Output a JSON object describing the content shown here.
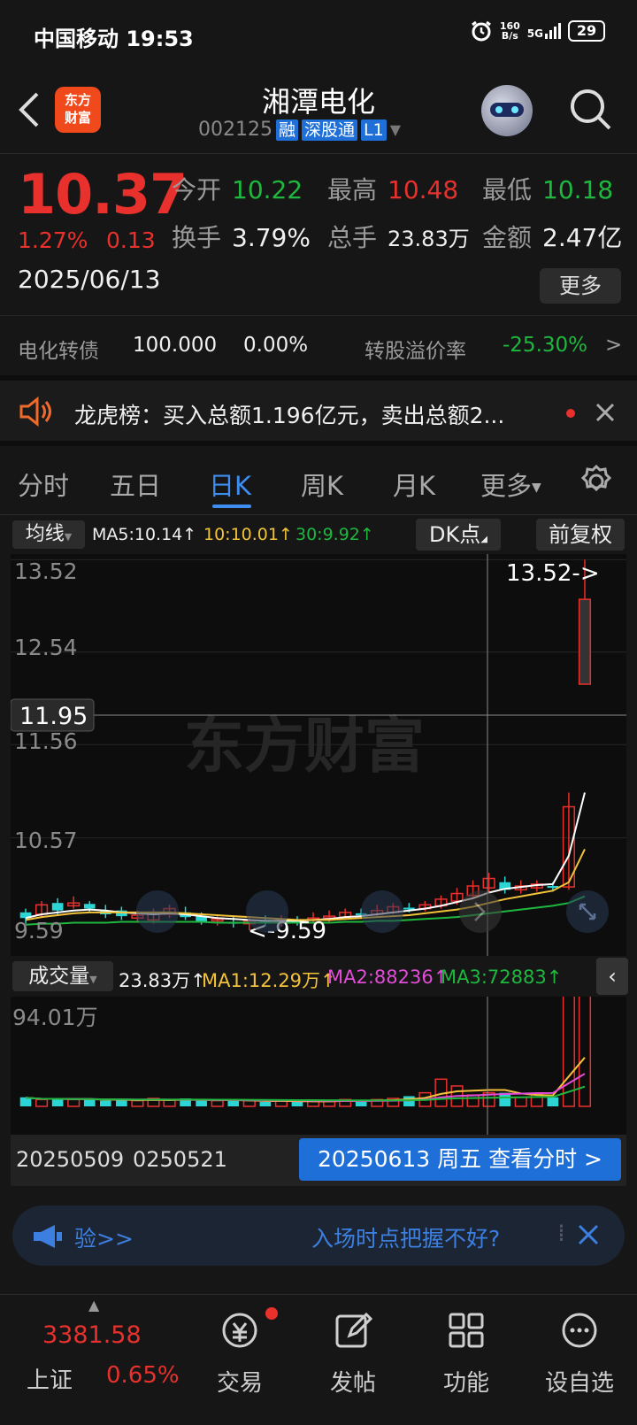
{
  "status_bar": {
    "carrier_time": "中国移动 19:53",
    "net_speed_top": "160",
    "net_speed_bottom": "B/s",
    "signal": "5G",
    "battery": "29"
  },
  "header": {
    "logo_text": "东方财富",
    "title": "湘潭电化",
    "code": "002125",
    "tags": [
      "融",
      "深股通",
      "L1"
    ]
  },
  "quote": {
    "price": "10.37",
    "change_pct": "1.27%",
    "change_amt": "0.13",
    "date": "2025/06/13",
    "open_label": "今开",
    "open": "10.22",
    "high_label": "最高",
    "high": "10.48",
    "low_label": "最低",
    "low": "10.18",
    "turnover_label": "换手",
    "turnover": "3.79%",
    "volume_label": "总手",
    "volume": "23.83万",
    "amount_label": "金额",
    "amount": "2.47亿",
    "more_label": "更多"
  },
  "bond": {
    "name": "电化转债",
    "price": "100.000",
    "pct": "0.00%",
    "premium_label": "转股溢价率",
    "premium": "-25.30%",
    "arrow": ">"
  },
  "notice": {
    "text": "龙虎榜：买入总额1.196亿元，卖出总额2..."
  },
  "tabs": [
    {
      "label": "分时"
    },
    {
      "label": "五日"
    },
    {
      "label": "日K"
    },
    {
      "label": "周K"
    },
    {
      "label": "月K"
    },
    {
      "label": "更多"
    }
  ],
  "chart_bar": {
    "ma_toggle": "均线",
    "ma5": "MA5:10.14↑",
    "ma10": "10:10.01↑",
    "ma30": "30:9.92↑",
    "dk_label": "DK点",
    "adjust_label": "前复权"
  },
  "kline": {
    "y_labels": [
      "13.52",
      "12.54",
      "11.56",
      "10.57",
      "9.59"
    ],
    "crosshair_price": "11.95",
    "max_marker": "13.52->",
    "min_marker": "<-9.59",
    "watermark": "东方财富"
  },
  "volume_bar": {
    "label": "成交量",
    "vol": "23.83万↑",
    "ma1": "MA1:12.29万↑",
    "ma2": "MA2:88236↑",
    "ma3": "MA3:72883↑",
    "axis_max": "94.01万"
  },
  "date_bar": {
    "start": "20250509",
    "mid": "0250521",
    "selected": "20250613 周五 查看分时 >"
  },
  "promo": {
    "left": "验>>",
    "right": "入场时点把握不好?"
  },
  "bottom_nav": {
    "index_value": "3381.58",
    "index_name": "上证",
    "index_pct": "0.65%",
    "items": [
      {
        "label": "交易"
      },
      {
        "label": "发帖"
      },
      {
        "label": "功能"
      },
      {
        "label": "设自选"
      }
    ]
  },
  "colors": {
    "up": "#e8312c",
    "down": "#1fb83f",
    "accent": "#3d8ef0",
    "bg": "#161616"
  },
  "chart_data": {
    "type": "candlestick",
    "y_range": [
      9.59,
      13.52
    ],
    "candles": [
      {
        "o": 9.78,
        "c": 9.72,
        "h": 9.82,
        "l": 9.66
      },
      {
        "o": 9.76,
        "c": 9.86,
        "h": 9.9,
        "l": 9.72
      },
      {
        "o": 9.88,
        "c": 9.8,
        "h": 9.93,
        "l": 9.76
      },
      {
        "o": 9.85,
        "c": 9.88,
        "h": 9.95,
        "l": 9.82
      },
      {
        "o": 9.87,
        "c": 9.82,
        "h": 9.9,
        "l": 9.78
      },
      {
        "o": 9.8,
        "c": 9.76,
        "h": 9.86,
        "l": 9.72
      },
      {
        "o": 9.8,
        "c": 9.74,
        "h": 9.84,
        "l": 9.7
      },
      {
        "o": 9.72,
        "c": 9.75,
        "h": 9.8,
        "l": 9.68
      },
      {
        "o": 9.7,
        "c": 9.76,
        "h": 9.82,
        "l": 9.66
      },
      {
        "o": 9.76,
        "c": 9.82,
        "h": 9.86,
        "l": 9.72
      },
      {
        "o": 9.78,
        "c": 9.73,
        "h": 9.84,
        "l": 9.7
      },
      {
        "o": 9.74,
        "c": 9.68,
        "h": 9.78,
        "l": 9.65
      },
      {
        "o": 9.69,
        "c": 9.71,
        "h": 9.75,
        "l": 9.64
      },
      {
        "o": 9.68,
        "c": 9.66,
        "h": 9.74,
        "l": 9.62
      },
      {
        "o": 9.66,
        "c": 9.69,
        "h": 9.74,
        "l": 9.59
      },
      {
        "o": 9.7,
        "c": 9.67,
        "h": 9.75,
        "l": 9.63
      },
      {
        "o": 9.67,
        "c": 9.7,
        "h": 9.75,
        "l": 9.63
      },
      {
        "o": 9.69,
        "c": 9.68,
        "h": 9.74,
        "l": 9.64
      },
      {
        "o": 9.7,
        "c": 9.72,
        "h": 9.78,
        "l": 9.66
      },
      {
        "o": 9.72,
        "c": 9.74,
        "h": 9.8,
        "l": 9.68
      },
      {
        "o": 9.73,
        "c": 9.78,
        "h": 9.82,
        "l": 9.7
      },
      {
        "o": 9.77,
        "c": 9.76,
        "h": 9.82,
        "l": 9.72
      },
      {
        "o": 9.76,
        "c": 9.8,
        "h": 9.86,
        "l": 9.74
      },
      {
        "o": 9.78,
        "c": 9.84,
        "h": 9.88,
        "l": 9.76
      },
      {
        "o": 9.83,
        "c": 9.82,
        "h": 9.88,
        "l": 9.78
      },
      {
        "o": 9.82,
        "c": 9.86,
        "h": 9.9,
        "l": 9.79
      },
      {
        "o": 9.85,
        "c": 9.92,
        "h": 9.96,
        "l": 9.82
      },
      {
        "o": 9.9,
        "c": 9.98,
        "h": 10.04,
        "l": 9.86
      },
      {
        "o": 9.96,
        "c": 10.06,
        "h": 10.12,
        "l": 9.92
      },
      {
        "o": 10.04,
        "c": 10.14,
        "h": 10.2,
        "l": 10.0
      },
      {
        "o": 10.1,
        "c": 10.02,
        "h": 10.16,
        "l": 9.98
      },
      {
        "o": 10.02,
        "c": 10.06,
        "h": 10.12,
        "l": 9.98
      },
      {
        "o": 10.04,
        "c": 10.08,
        "h": 10.12,
        "l": 10.0
      },
      {
        "o": 10.06,
        "c": 10.04,
        "h": 10.1,
        "l": 10.0
      },
      {
        "o": 10.05,
        "c": 10.9,
        "h": 11.05,
        "l": 10.02
      },
      {
        "o": 12.2,
        "c": 13.1,
        "h": 13.52,
        "l": 12.2
      }
    ],
    "ma5": [
      9.72,
      9.76,
      9.78,
      9.8,
      9.81,
      9.8,
      9.78,
      9.77,
      9.76,
      9.77,
      9.76,
      9.74,
      9.72,
      9.71,
      9.7,
      9.69,
      9.69,
      9.69,
      9.7,
      9.71,
      9.73,
      9.74,
      9.76,
      9.78,
      9.8,
      9.82,
      9.85,
      9.89,
      9.93,
      9.99,
      10.03,
      10.05,
      10.07,
      10.08,
      10.38,
      11.05
    ],
    "ma10": [
      9.7,
      9.73,
      9.75,
      9.77,
      9.78,
      9.78,
      9.78,
      9.78,
      9.78,
      9.78,
      9.77,
      9.76,
      9.75,
      9.74,
      9.73,
      9.72,
      9.71,
      9.7,
      9.7,
      9.7,
      9.71,
      9.72,
      9.73,
      9.74,
      9.75,
      9.77,
      9.79,
      9.81,
      9.84,
      9.88,
      9.92,
      9.95,
      9.98,
      10.01,
      10.1,
      10.45
    ],
    "ma30": [
      9.65,
      9.66,
      9.66,
      9.67,
      9.67,
      9.67,
      9.68,
      9.68,
      9.68,
      9.68,
      9.68,
      9.68,
      9.67,
      9.67,
      9.67,
      9.67,
      9.67,
      9.67,
      9.67,
      9.67,
      9.68,
      9.68,
      9.69,
      9.69,
      9.7,
      9.71,
      9.72,
      9.73,
      9.75,
      9.77,
      9.79,
      9.81,
      9.83,
      9.85,
      9.88,
      9.95
    ],
    "volume_max": 940100,
    "volumes": [
      0.08,
      0.06,
      0.07,
      0.06,
      0.07,
      0.05,
      0.06,
      0.05,
      0.07,
      0.06,
      0.07,
      0.05,
      0.05,
      0.06,
      0.05,
      0.04,
      0.05,
      0.04,
      0.05,
      0.05,
      0.06,
      0.05,
      0.06,
      0.07,
      0.09,
      0.12,
      0.24,
      0.18,
      0.1,
      0.12,
      0.12,
      0.08,
      0.11,
      0.08,
      1.0,
      1.0
    ]
  }
}
